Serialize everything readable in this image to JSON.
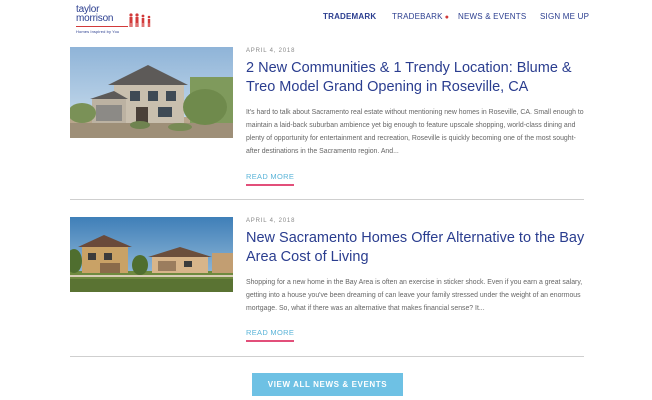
{
  "brand": {
    "name_line1": "taylor",
    "name_line2": "morrison",
    "tagline": "Homes Inspired by You"
  },
  "nav": {
    "items": [
      "TRADEMARK",
      "TRADEBARK",
      "NEWS & EVENTS",
      "SIGN ME UP"
    ]
  },
  "posts": [
    {
      "date": "APRIL 4, 2018",
      "title": "2 New Communities & 1 Trendy Location: Blume & Treo Model Grand Opening in Roseville, CA",
      "excerpt": "It's hard to talk about Sacramento real estate without mentioning new homes in Roseville, CA. Small enough to maintain a laid-back suburban ambience yet big enough to feature upscale shopping, world-class dining and plenty of opportunity for entertainment and recreation, Roseville is quickly becoming one of the most sought-after destinations in the Sacramento region. And...",
      "read_more": "READ MORE"
    },
    {
      "date": "APRIL 4, 2018",
      "title": "New Sacramento Homes Offer Alternative to the Bay Area Cost of Living",
      "excerpt": "Shopping for a new home in the Bay Area is often an exercise in sticker shock. Even if you earn a great salary, getting into a house you've been dreaming of can leave your family stressed under the weight of an enormous mortgage. So, what if there was an alternative that makes financial sense? It...",
      "read_more": "READ MORE"
    }
  ],
  "cta": {
    "label": "VIEW ALL NEWS & EVENTS"
  },
  "colors": {
    "navy": "#2a3d8f",
    "accent_red": "#d23a3a",
    "link_blue": "#5ab4d8",
    "underline_pink": "#e24f7a",
    "button": "#6ec1e4"
  }
}
